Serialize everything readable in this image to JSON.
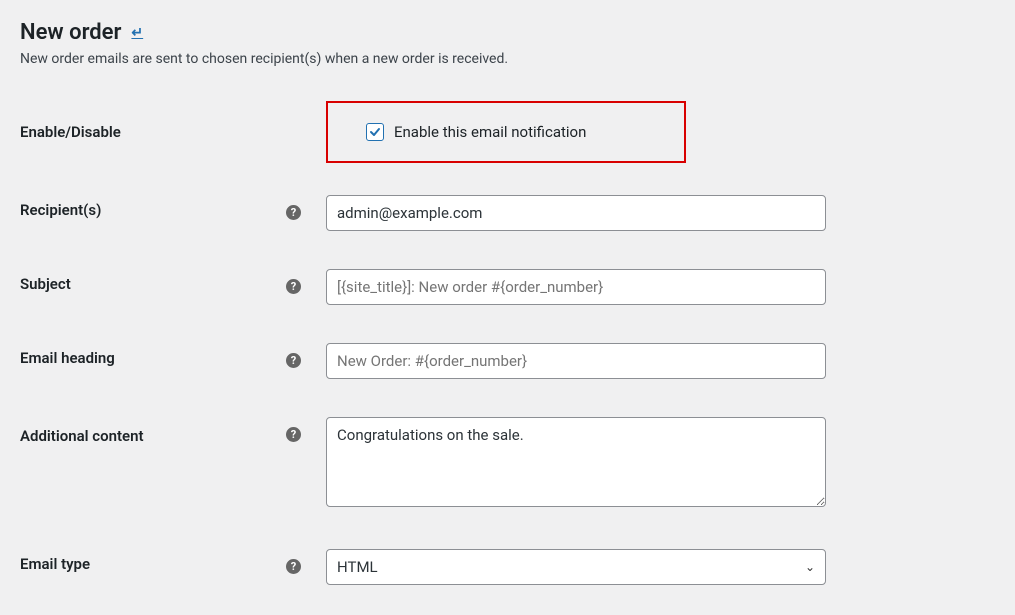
{
  "header": {
    "title": "New order",
    "description": "New order emails are sent to chosen recipient(s) when a new order is received."
  },
  "form": {
    "enable": {
      "label": "Enable/Disable",
      "checkbox_label": "Enable this email notification",
      "checked": true
    },
    "recipients": {
      "label": "Recipient(s)",
      "value": "admin@example.com"
    },
    "subject": {
      "label": "Subject",
      "placeholder": "[{site_title}]: New order #{order_number}"
    },
    "heading": {
      "label": "Email heading",
      "placeholder": "New Order: #{order_number}"
    },
    "additional": {
      "label": "Additional content",
      "value": "Congratulations on the sale."
    },
    "email_type": {
      "label": "Email type",
      "selected": "HTML"
    }
  }
}
